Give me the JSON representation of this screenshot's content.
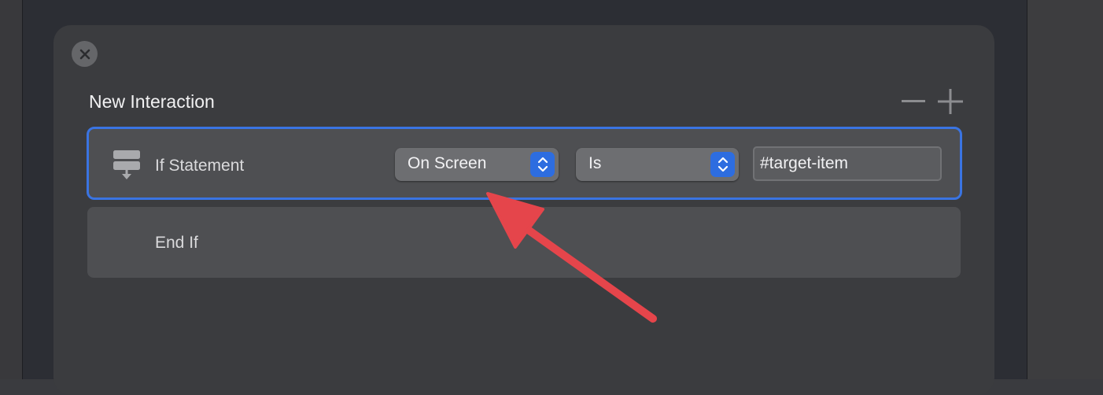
{
  "sheet": {
    "title": "New Interaction"
  },
  "icons": {
    "close": "close-icon",
    "minus": "minus-icon",
    "plus": "plus-icon",
    "if_statement": "if-statement-icon",
    "stepper": "chevron-up-down-icon",
    "annotation": "red-arrow"
  },
  "if_row": {
    "label": "If Statement",
    "condition_select": {
      "selected": "On Screen"
    },
    "operator_select": {
      "selected": "Is"
    },
    "target_input": {
      "value": "#target-item"
    }
  },
  "end_row": {
    "label": "End If"
  },
  "colors": {
    "accent": "#3a74e2",
    "stepper": "#2d6de0",
    "annotation_arrow": "#e5454b"
  }
}
